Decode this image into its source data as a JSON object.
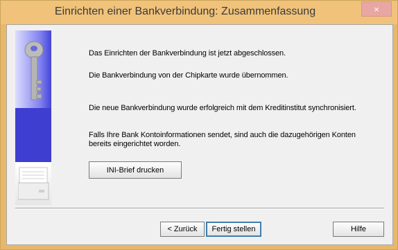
{
  "window": {
    "title": "Einrichten einer Bankverbindung: Zusammenfassung",
    "close_glyph": "×"
  },
  "messages": {
    "line1": "Das Einrichten der Bankverbindung ist jetzt abgeschlossen.",
    "line2": "Die Bankverbindung von der Chipkarte wurde übernommen.",
    "line3": "Die neue Bankverbindung wurde erfolgreich mit dem Kreditinstitut synchronisiert.",
    "line4a": "Falls Ihre Bank Kontoinformationen sendet, sind auch die dazugehörigen Konten",
    "line4b": "bereits eingerichtet worden."
  },
  "buttons": {
    "ini_letter": "INI-Brief drucken",
    "back": "< Zurück",
    "finish": "Fertig stellen",
    "help": "Hilfe"
  },
  "icons": {
    "key": "key-icon",
    "printer": "printer-icon"
  },
  "colors": {
    "titlebar": "#f0c27a",
    "panel_blue": "#3e3ed0",
    "close": "#e8a7a3"
  }
}
